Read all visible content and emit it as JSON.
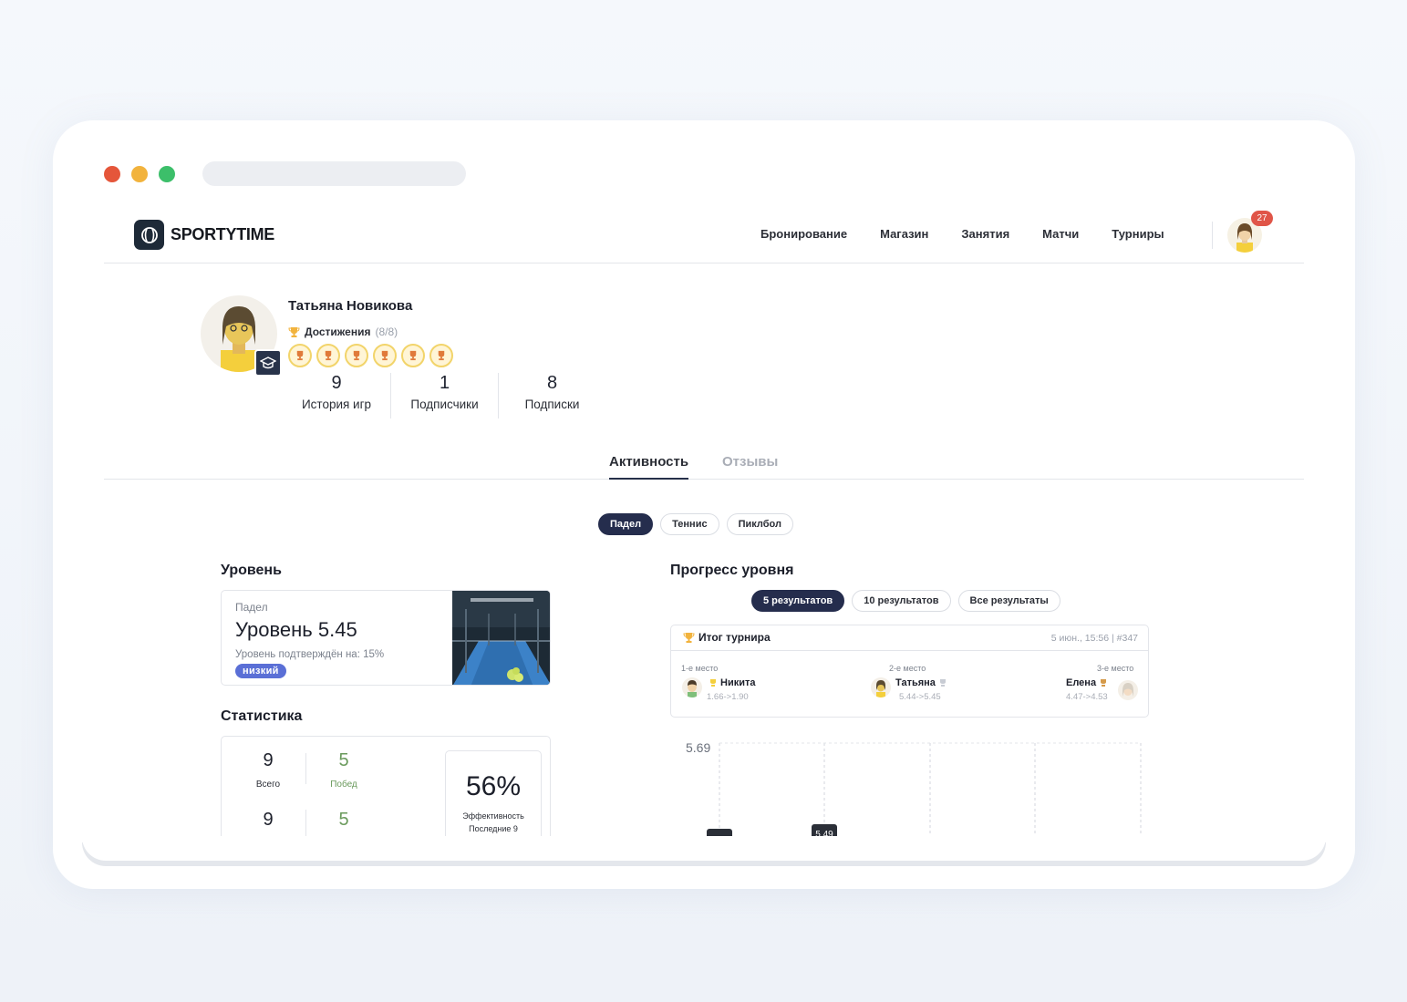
{
  "brand": {
    "name": "SPORTYTIME"
  },
  "nav": [
    "Бронирование",
    "Магазин",
    "Занятия",
    "Матчи",
    "Турниры"
  ],
  "notifications": {
    "count": "27"
  },
  "profile": {
    "name": "Татьяна Новикова",
    "achievements_label": "Достижения",
    "achievements_count": "(8/8)",
    "medals": 6,
    "stats": [
      {
        "value": "9",
        "label": "История игр"
      },
      {
        "value": "1",
        "label": "Подписчики"
      },
      {
        "value": "8",
        "label": "Подписки"
      }
    ]
  },
  "tabs": {
    "activity": "Активность",
    "reviews": "Отзывы"
  },
  "sports": [
    "Падел",
    "Теннис",
    "Пиклбол"
  ],
  "level": {
    "heading": "Уровень",
    "sport": "Падел",
    "value": "Уровень 5.45",
    "confirmed": "Уровень подтверждён на: 15%",
    "badge": "низкий"
  },
  "statistics": {
    "heading": "Статистика",
    "total": "9",
    "total_label": "Всего",
    "wins": "5",
    "wins_label": "Побед",
    "total2": "9",
    "wins2": "5",
    "efficiency": "56%",
    "efficiency_label": "Эффективность",
    "efficiency_sub": "Последние 9"
  },
  "progress": {
    "heading": "Прогресс уровня",
    "filters": [
      "5 результатов",
      "10 результатов",
      "Все результаты"
    ],
    "tournament": {
      "title": "Итог турнира",
      "meta": "5 июн., 15:56 | #347",
      "places": [
        {
          "place": "1-е место",
          "name": "Никита",
          "delta": "1.66->1.90"
        },
        {
          "place": "2-е место",
          "name": "Татьяна",
          "delta": "5.44->5.45"
        },
        {
          "place": "3-е место",
          "name": "Елена",
          "delta": "4.47->4.53"
        }
      ]
    },
    "chart_data": {
      "type": "line",
      "y_top_label": "5.69",
      "points": [
        {
          "label": ""
        },
        {
          "label": "5.49"
        }
      ]
    }
  },
  "colors": {
    "dot_red": "#e5563a",
    "dot_yellow": "#f2b33d",
    "dot_green": "#3cbf6a",
    "primary": "#252d4d",
    "wins_green": "#6a9a5c",
    "badge_blue": "#5a6fd6",
    "notif_red": "#e05548"
  }
}
